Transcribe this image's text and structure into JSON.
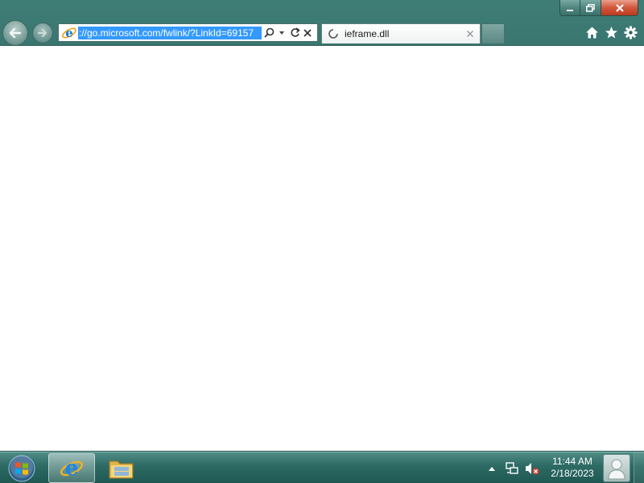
{
  "browser": {
    "address_bar": {
      "url_display": "://go.microsoft.com/fwlink/?LinkId=69157"
    },
    "tab": {
      "title": "ieframe.dll"
    },
    "icons": {
      "back": "back-arrow-icon",
      "forward": "forward-arrow-icon",
      "search": "search-icon",
      "dropdown": "chevron-down-icon",
      "refresh": "refresh-icon",
      "stop": "close-icon",
      "home": "home-icon",
      "favorites": "star-icon",
      "tools": "gear-icon",
      "tab_loading": "loading-spinner-icon"
    }
  },
  "taskbar": {
    "clock": {
      "time": "11:44 AM",
      "date": "2/18/2023"
    },
    "items": [
      "Internet Explorer",
      "Windows Explorer"
    ]
  },
  "colors": {
    "frame": "#2b625d",
    "selection": "#3399ff",
    "close_button": "#d2573c"
  }
}
